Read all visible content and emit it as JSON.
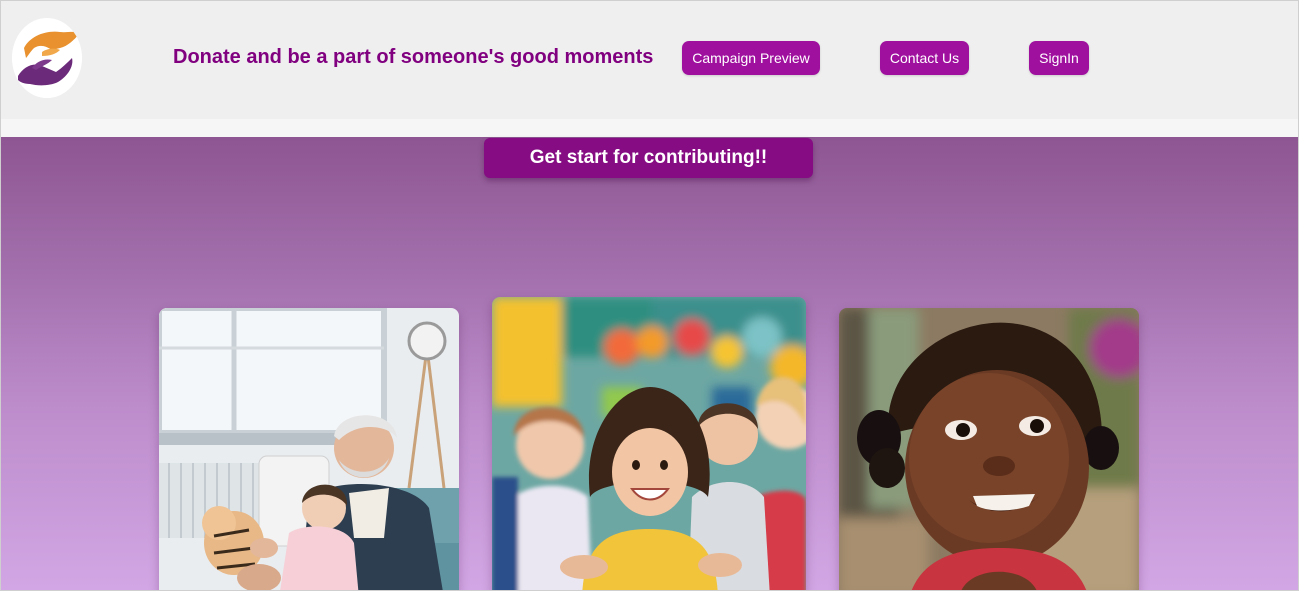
{
  "header": {
    "tagline": "Donate and be a part of someone's good moments",
    "nav": {
      "campaign_preview": "Campaign Preview",
      "contact_us": "Contact Us",
      "signin": "SignIn"
    }
  },
  "hero": {
    "cta_label": "Get start for contributing!!"
  },
  "colors": {
    "brand_purple": "#800080",
    "button_purple": "#a0109f",
    "header_bg": "#efefef",
    "logo_orange": "#e8912e"
  },
  "icons": {
    "logo": "hands-heart-logo"
  }
}
